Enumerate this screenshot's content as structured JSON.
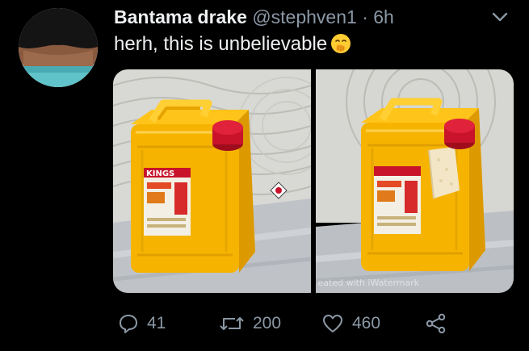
{
  "tweet": {
    "display_name": "Bantama drake",
    "handle": "@stephven1",
    "separator": "·",
    "time": "6h",
    "text": "herh, this is unbelievable",
    "emoji": "hand-over-mouth-emoji",
    "media": {
      "count": 2,
      "watermark": "eated with iWatermark",
      "jerrycan_label": "KINGS"
    },
    "actions": {
      "reply_count": "41",
      "retweet_count": "200",
      "like_count": "460",
      "share_icon": "share-icon"
    },
    "colors": {
      "background": "#000000",
      "text": "#e7e9ea",
      "secondary": "#8b98a5",
      "jerrycan": "#f5b800",
      "cap": "#d3132a"
    }
  }
}
